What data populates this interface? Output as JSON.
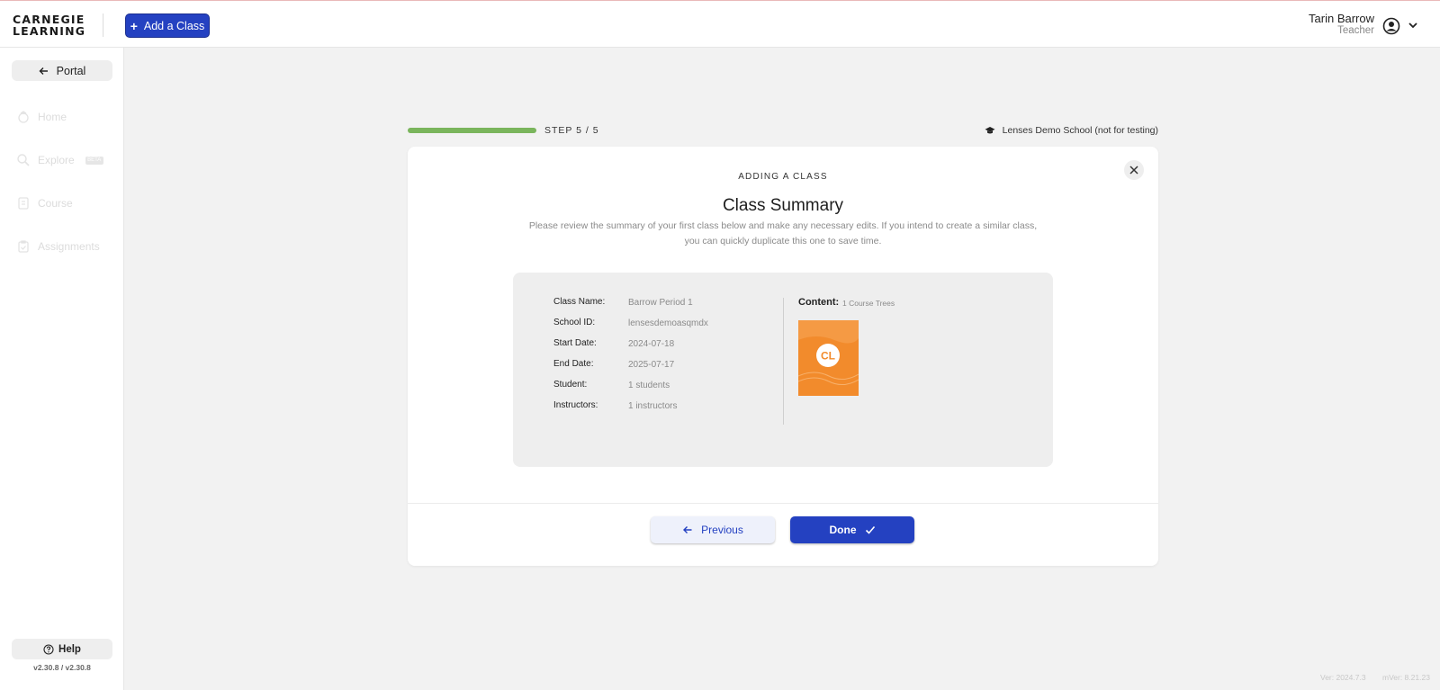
{
  "header": {
    "logo_line1": "CARNEGIE",
    "logo_line2": "LEARNING",
    "add_class_label": "Add a Class",
    "user_name": "Tarin Barrow",
    "user_role": "Teacher"
  },
  "sidebar": {
    "portal_label": "Portal",
    "items": [
      {
        "label": "Home",
        "icon": "home-icon"
      },
      {
        "label": "Explore",
        "icon": "search-icon",
        "badge": "BETA"
      },
      {
        "label": "Course",
        "icon": "course-icon"
      },
      {
        "label": "Assignments",
        "icon": "assignments-icon"
      }
    ],
    "help_label": "Help",
    "version": "v2.30.8 / v2.30.8"
  },
  "progress": {
    "fraction": 1.0,
    "step_label": "STEP 5 / 5",
    "school": "Lenses Demo School (not for testing)"
  },
  "card": {
    "eyebrow": "ADDING A CLASS",
    "title": "Class Summary",
    "description_line1": "Please review the summary of your first class below and make any necessary edits. If you intend to create a similar class,",
    "description_line2": "you can quickly duplicate this one to save time.",
    "fields": [
      {
        "label": "Class Name:",
        "value": "Barrow Period 1"
      },
      {
        "label": "School ID:",
        "value": "lensesdemoasqmdx"
      },
      {
        "label": "Start Date:",
        "value": "2024-07-18"
      },
      {
        "label": "End Date:",
        "value": "2025-07-17"
      },
      {
        "label": "Student:",
        "value": "1 students"
      },
      {
        "label": "Instructors:",
        "value": "1 instructors"
      }
    ],
    "content_label": "Content:",
    "content_count": "1 Course Trees",
    "thumb_logo": "CL",
    "previous_label": "Previous",
    "done_label": "Done"
  },
  "footer": {
    "ver": "Ver: 2024.7.3",
    "mver": "mVer: 8.21.23"
  },
  "colors": {
    "primary": "#2441c1",
    "progress": "#7ab55c",
    "content_thumb": "#f28b2c"
  }
}
